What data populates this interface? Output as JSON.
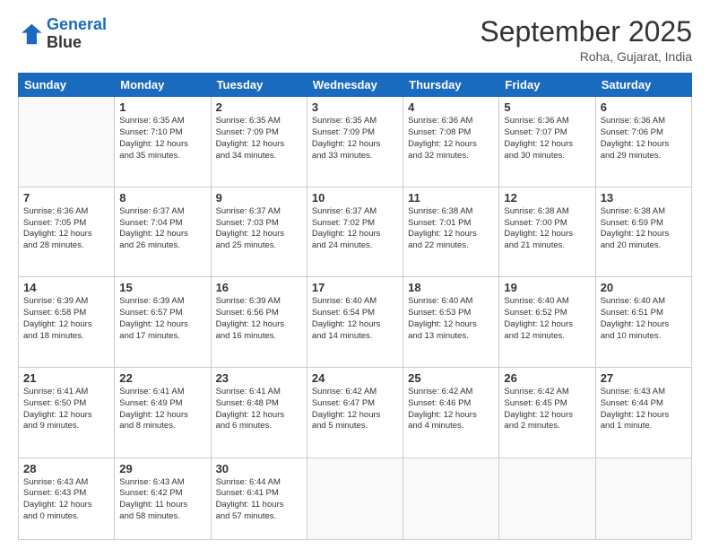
{
  "header": {
    "logo_line1": "General",
    "logo_line2": "Blue",
    "month": "September 2025",
    "location": "Roha, Gujarat, India"
  },
  "weekdays": [
    "Sunday",
    "Monday",
    "Tuesday",
    "Wednesday",
    "Thursday",
    "Friday",
    "Saturday"
  ],
  "weeks": [
    [
      {
        "day": "",
        "info": ""
      },
      {
        "day": "1",
        "info": "Sunrise: 6:35 AM\nSunset: 7:10 PM\nDaylight: 12 hours\nand 35 minutes."
      },
      {
        "day": "2",
        "info": "Sunrise: 6:35 AM\nSunset: 7:09 PM\nDaylight: 12 hours\nand 34 minutes."
      },
      {
        "day": "3",
        "info": "Sunrise: 6:35 AM\nSunset: 7:09 PM\nDaylight: 12 hours\nand 33 minutes."
      },
      {
        "day": "4",
        "info": "Sunrise: 6:36 AM\nSunset: 7:08 PM\nDaylight: 12 hours\nand 32 minutes."
      },
      {
        "day": "5",
        "info": "Sunrise: 6:36 AM\nSunset: 7:07 PM\nDaylight: 12 hours\nand 30 minutes."
      },
      {
        "day": "6",
        "info": "Sunrise: 6:36 AM\nSunset: 7:06 PM\nDaylight: 12 hours\nand 29 minutes."
      }
    ],
    [
      {
        "day": "7",
        "info": "Sunrise: 6:36 AM\nSunset: 7:05 PM\nDaylight: 12 hours\nand 28 minutes."
      },
      {
        "day": "8",
        "info": "Sunrise: 6:37 AM\nSunset: 7:04 PM\nDaylight: 12 hours\nand 26 minutes."
      },
      {
        "day": "9",
        "info": "Sunrise: 6:37 AM\nSunset: 7:03 PM\nDaylight: 12 hours\nand 25 minutes."
      },
      {
        "day": "10",
        "info": "Sunrise: 6:37 AM\nSunset: 7:02 PM\nDaylight: 12 hours\nand 24 minutes."
      },
      {
        "day": "11",
        "info": "Sunrise: 6:38 AM\nSunset: 7:01 PM\nDaylight: 12 hours\nand 22 minutes."
      },
      {
        "day": "12",
        "info": "Sunrise: 6:38 AM\nSunset: 7:00 PM\nDaylight: 12 hours\nand 21 minutes."
      },
      {
        "day": "13",
        "info": "Sunrise: 6:38 AM\nSunset: 6:59 PM\nDaylight: 12 hours\nand 20 minutes."
      }
    ],
    [
      {
        "day": "14",
        "info": "Sunrise: 6:39 AM\nSunset: 6:58 PM\nDaylight: 12 hours\nand 18 minutes."
      },
      {
        "day": "15",
        "info": "Sunrise: 6:39 AM\nSunset: 6:57 PM\nDaylight: 12 hours\nand 17 minutes."
      },
      {
        "day": "16",
        "info": "Sunrise: 6:39 AM\nSunset: 6:56 PM\nDaylight: 12 hours\nand 16 minutes."
      },
      {
        "day": "17",
        "info": "Sunrise: 6:40 AM\nSunset: 6:54 PM\nDaylight: 12 hours\nand 14 minutes."
      },
      {
        "day": "18",
        "info": "Sunrise: 6:40 AM\nSunset: 6:53 PM\nDaylight: 12 hours\nand 13 minutes."
      },
      {
        "day": "19",
        "info": "Sunrise: 6:40 AM\nSunset: 6:52 PM\nDaylight: 12 hours\nand 12 minutes."
      },
      {
        "day": "20",
        "info": "Sunrise: 6:40 AM\nSunset: 6:51 PM\nDaylight: 12 hours\nand 10 minutes."
      }
    ],
    [
      {
        "day": "21",
        "info": "Sunrise: 6:41 AM\nSunset: 6:50 PM\nDaylight: 12 hours\nand 9 minutes."
      },
      {
        "day": "22",
        "info": "Sunrise: 6:41 AM\nSunset: 6:49 PM\nDaylight: 12 hours\nand 8 minutes."
      },
      {
        "day": "23",
        "info": "Sunrise: 6:41 AM\nSunset: 6:48 PM\nDaylight: 12 hours\nand 6 minutes."
      },
      {
        "day": "24",
        "info": "Sunrise: 6:42 AM\nSunset: 6:47 PM\nDaylight: 12 hours\nand 5 minutes."
      },
      {
        "day": "25",
        "info": "Sunrise: 6:42 AM\nSunset: 6:46 PM\nDaylight: 12 hours\nand 4 minutes."
      },
      {
        "day": "26",
        "info": "Sunrise: 6:42 AM\nSunset: 6:45 PM\nDaylight: 12 hours\nand 2 minutes."
      },
      {
        "day": "27",
        "info": "Sunrise: 6:43 AM\nSunset: 6:44 PM\nDaylight: 12 hours\nand 1 minute."
      }
    ],
    [
      {
        "day": "28",
        "info": "Sunrise: 6:43 AM\nSunset: 6:43 PM\nDaylight: 12 hours\nand 0 minutes."
      },
      {
        "day": "29",
        "info": "Sunrise: 6:43 AM\nSunset: 6:42 PM\nDaylight: 11 hours\nand 58 minutes."
      },
      {
        "day": "30",
        "info": "Sunrise: 6:44 AM\nSunset: 6:41 PM\nDaylight: 11 hours\nand 57 minutes."
      },
      {
        "day": "",
        "info": ""
      },
      {
        "day": "",
        "info": ""
      },
      {
        "day": "",
        "info": ""
      },
      {
        "day": "",
        "info": ""
      }
    ]
  ]
}
